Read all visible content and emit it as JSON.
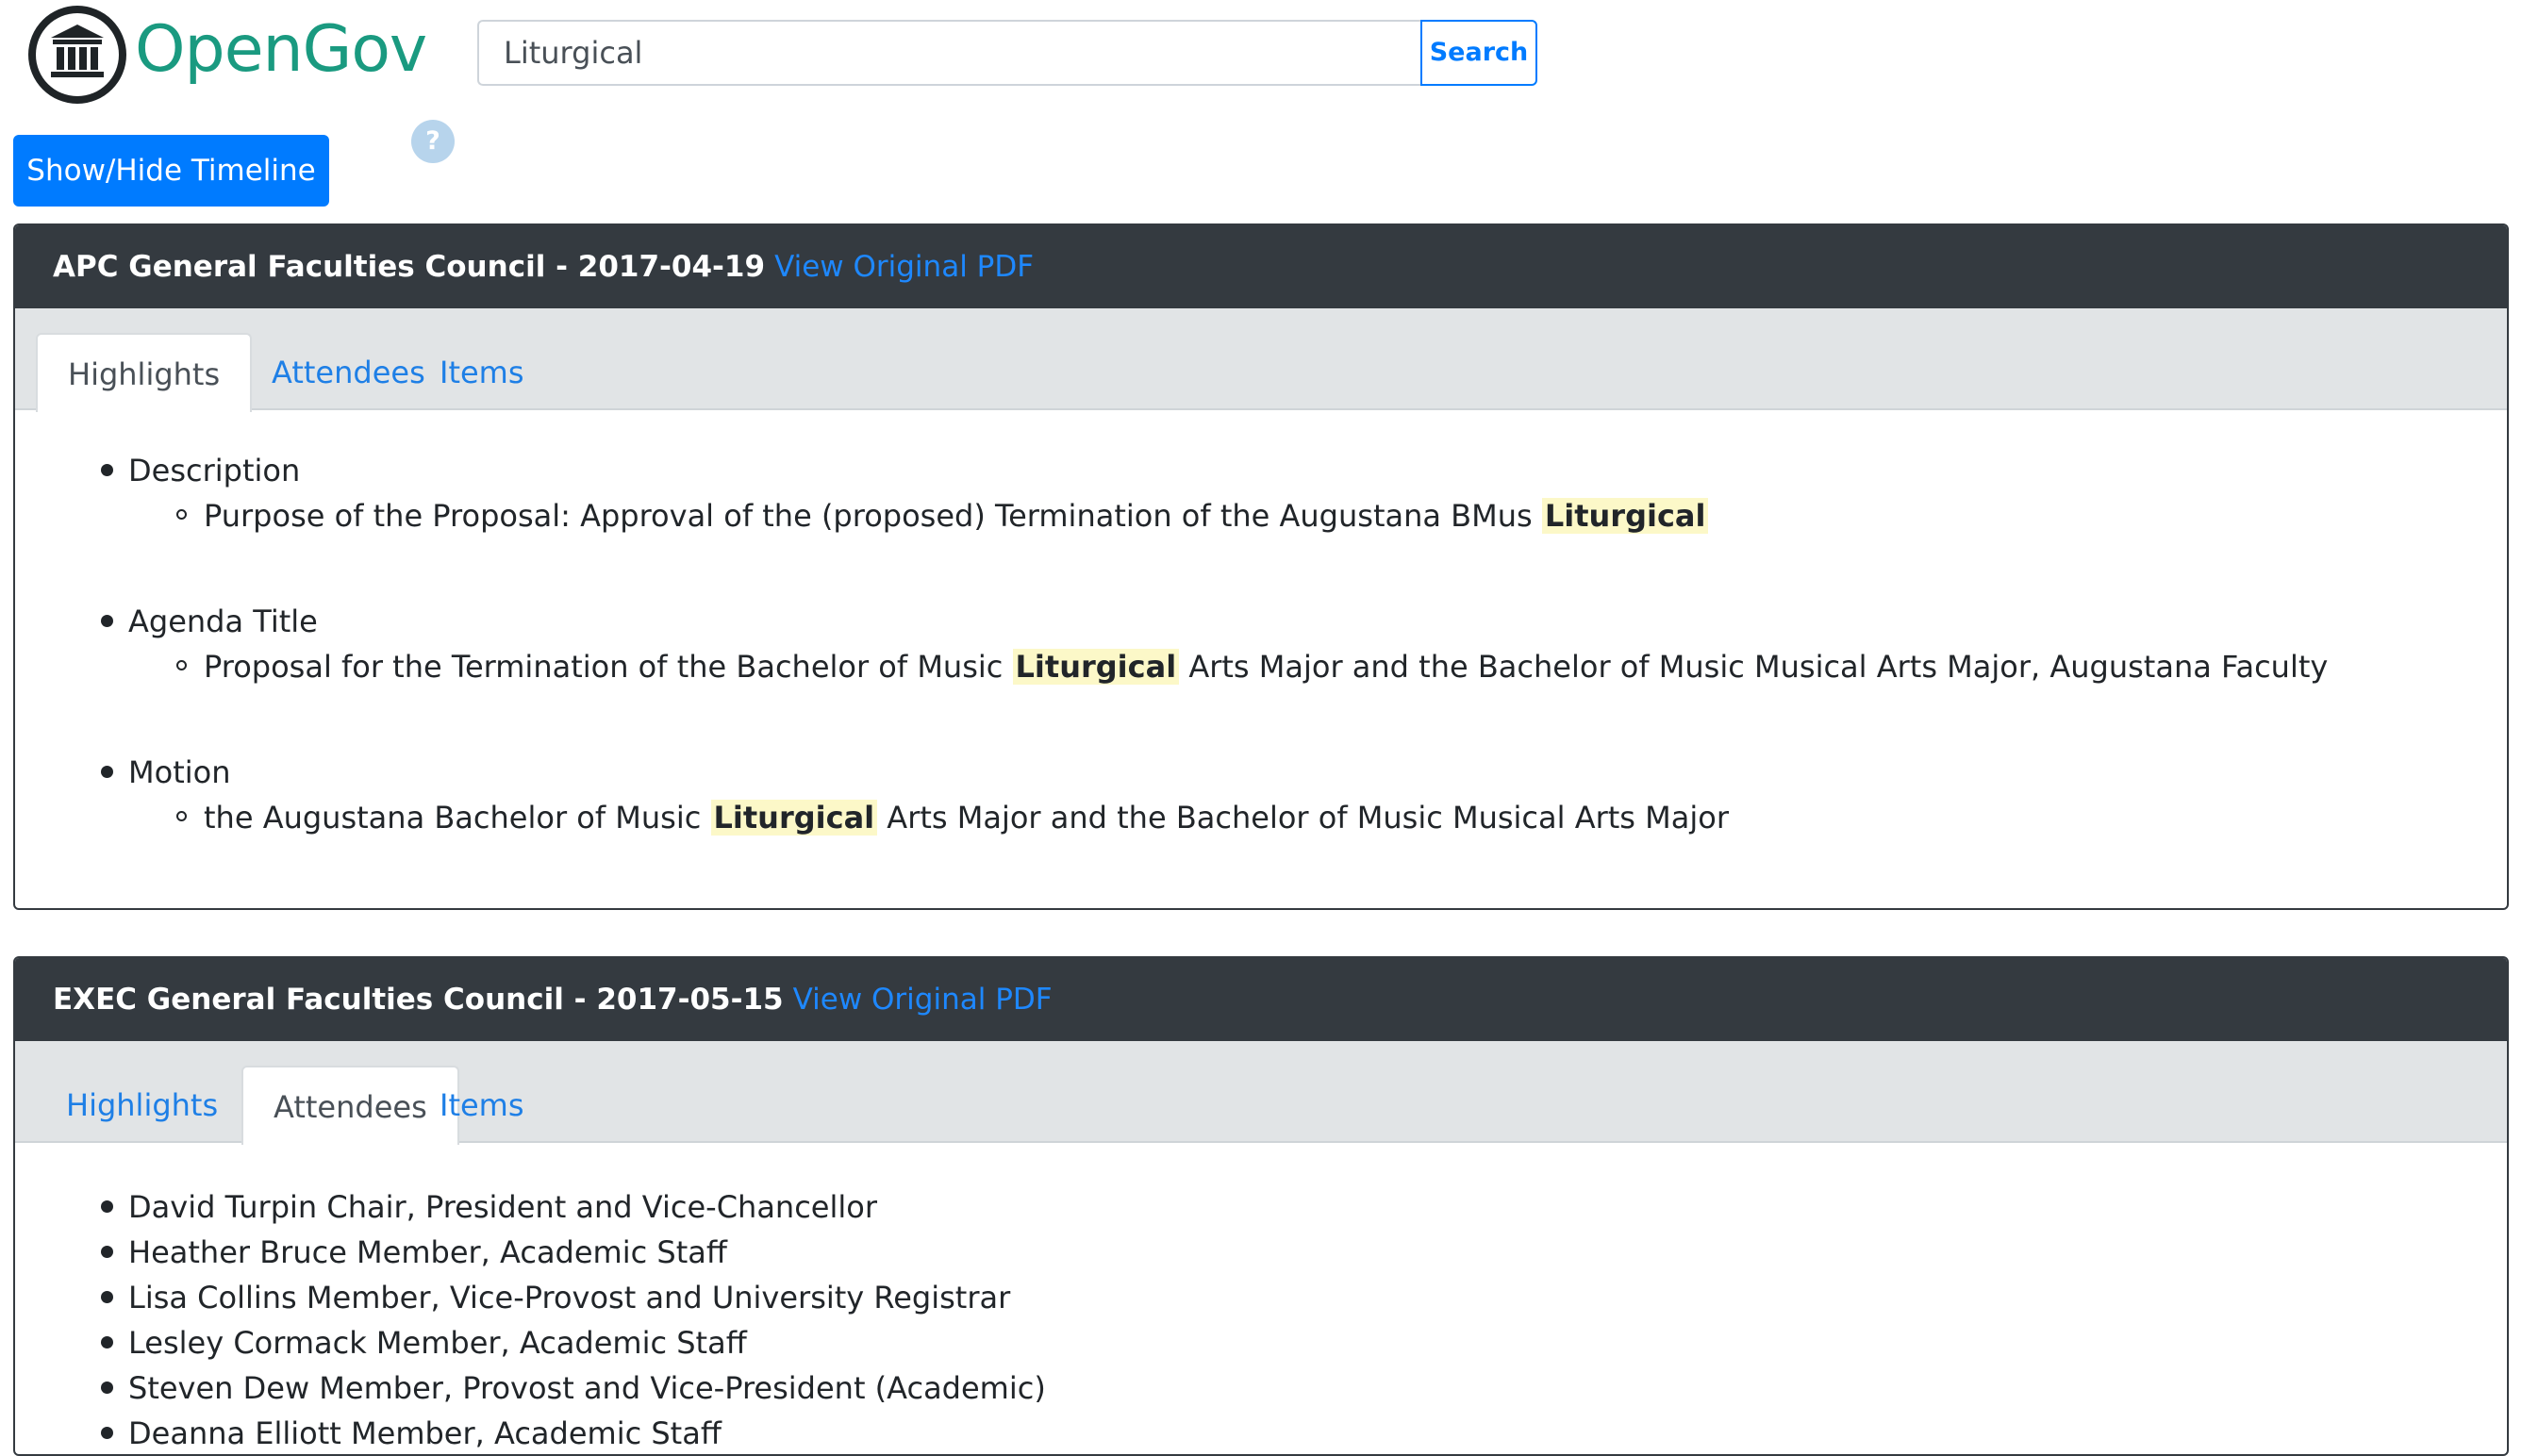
{
  "brand": {
    "name": "OpenGov",
    "logo_icon": "bank-building-icon",
    "accent": "#1a9a80"
  },
  "search": {
    "value": "Liturgical",
    "button_label": "Search"
  },
  "timeline_button": {
    "label": "Show/Hide Timeline"
  },
  "help": {
    "label": "?"
  },
  "cards": [
    {
      "title": "APC General Faculties Council - 2017-04-19",
      "pdf_link": "View Original PDF",
      "tabs": [
        "Highlights",
        "Attendees",
        "Items"
      ],
      "active_tab": "Highlights",
      "highlights": [
        {
          "title": "Description",
          "pre": "Purpose of the Proposal: Approval of the (proposed) Termination of the Augustana BMus ",
          "match": "Liturgical",
          "post": ""
        },
        {
          "title": "Agenda Title",
          "pre": "Proposal for the Termination of the Bachelor of Music ",
          "match": "Liturgical",
          "post": " Arts Major and the Bachelor of Music Musical Arts Major, Augustana Faculty"
        },
        {
          "title": "Motion",
          "pre": "the Augustana Bachelor of Music ",
          "match": "Liturgical",
          "post": " Arts Major and the Bachelor of Music Musical Arts Major"
        }
      ]
    },
    {
      "title": "EXEC General Faculties Council - 2017-05-15",
      "pdf_link": "View Original PDF",
      "tabs": [
        "Highlights",
        "Attendees",
        "Items"
      ],
      "active_tab": "Attendees",
      "attendees": [
        "David Turpin Chair, President and Vice-Chancellor",
        "Heather Bruce Member, Academic Staff",
        "Lisa Collins Member, Vice-Provost and University Registrar",
        "Lesley Cormack Member, Academic Staff",
        "Steven Dew Member, Provost and Vice-President (Academic)",
        "Deanna Elliott Member, Academic Staff"
      ]
    }
  ],
  "colors": {
    "primary": "#007bff",
    "header_bg": "#343a40",
    "link": "#1e88ff",
    "highlight": "#fcf8c8",
    "tab_bar": "#e1e4e6"
  }
}
